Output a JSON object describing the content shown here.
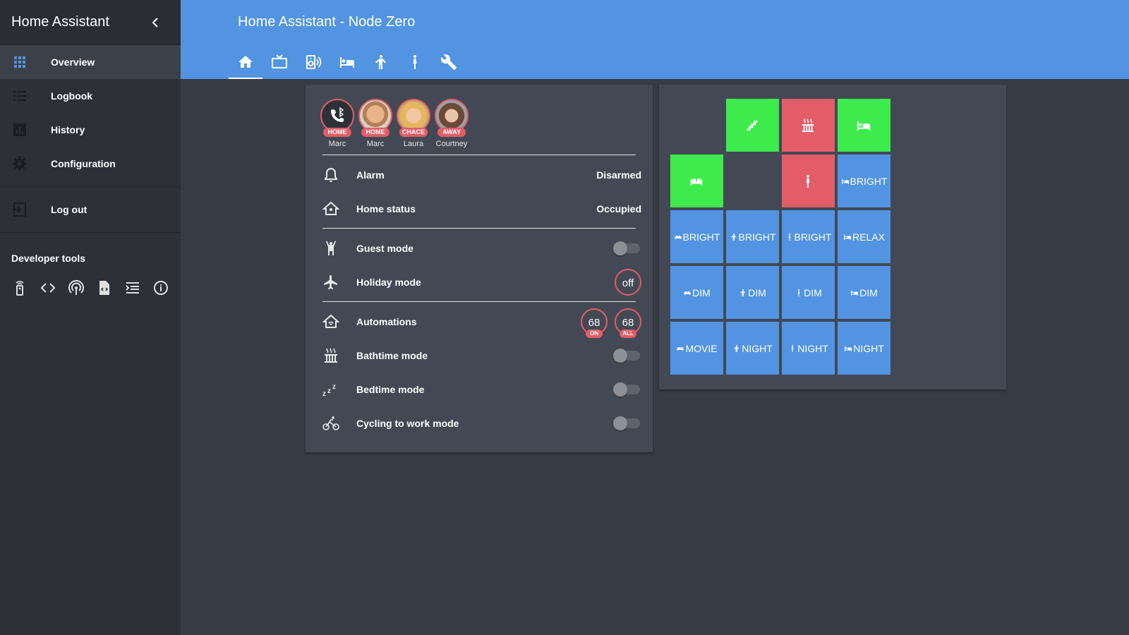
{
  "app": {
    "title": "Home Assistant",
    "page_title": "Home Assistant - Node Zero"
  },
  "sidebar": {
    "items": [
      {
        "label": "Overview",
        "icon": "apps-grid-icon"
      },
      {
        "label": "Logbook",
        "icon": "list-icon"
      },
      {
        "label": "History",
        "icon": "chart-icon"
      },
      {
        "label": "Configuration",
        "icon": "gear-icon"
      }
    ],
    "logout_label": "Log out",
    "dev_tools_title": "Developer tools",
    "dev_tools": [
      "remote-icon",
      "code-icon",
      "broadcast-icon",
      "file-code-icon",
      "log-icon",
      "info-icon"
    ]
  },
  "tabs": [
    "home-icon",
    "tv-icon",
    "speaker-icon",
    "bed-icon",
    "man-icon",
    "woman-icon",
    "wrench-icon"
  ],
  "people": [
    {
      "name": "Marc",
      "state": "HOME",
      "avatar": "phone-bluetooth-icon"
    },
    {
      "name": "Marc",
      "state": "HOME",
      "avatar": "photo"
    },
    {
      "name": "Laura",
      "state": "CHACE",
      "avatar": "photo"
    },
    {
      "name": "Courtney",
      "state": "AWAY",
      "avatar": "photo"
    }
  ],
  "rows": {
    "alarm": {
      "label": "Alarm",
      "value": "Disarmed"
    },
    "home_status": {
      "label": "Home status",
      "value": "Occupied"
    },
    "guest_mode": {
      "label": "Guest mode",
      "state": "off"
    },
    "holiday_mode": {
      "label": "Holiday mode",
      "value": "off"
    },
    "automations": {
      "label": "Automations",
      "on_count": "68",
      "on_label": "ON",
      "all_count": "68",
      "all_label": "ALL"
    },
    "bathtime_mode": {
      "label": "Bathtime mode",
      "state": "off"
    },
    "bedtime_mode": {
      "label": "Bedtime mode",
      "state": "off"
    },
    "cycling_mode": {
      "label": "Cycling to work mode",
      "state": "off"
    }
  },
  "tiles": [
    {
      "row": 0,
      "col": 1,
      "color": "green",
      "icon": "stairs-icon",
      "label": ""
    },
    {
      "row": 0,
      "col": 2,
      "color": "red",
      "icon": "radiator-icon",
      "label": ""
    },
    {
      "row": 0,
      "col": 3,
      "color": "green",
      "icon": "bed-icon",
      "label": ""
    },
    {
      "row": 1,
      "col": 0,
      "color": "green",
      "icon": "sofa-icon",
      "label": ""
    },
    {
      "row": 1,
      "col": 2,
      "color": "red",
      "icon": "woman-icon",
      "label": ""
    },
    {
      "row": 1,
      "col": 3,
      "color": "blue",
      "icon": "bed-icon",
      "label": "BRIGHT"
    },
    {
      "row": 2,
      "col": 0,
      "color": "blue",
      "icon": "sofa-icon",
      "label": "BRIGHT"
    },
    {
      "row": 2,
      "col": 1,
      "color": "blue",
      "icon": "man-icon",
      "label": "BRIGHT"
    },
    {
      "row": 2,
      "col": 2,
      "color": "blue",
      "icon": "woman-icon",
      "label": "BRIGHT"
    },
    {
      "row": 2,
      "col": 3,
      "color": "blue",
      "icon": "bed-icon",
      "label": "RELAX"
    },
    {
      "row": 3,
      "col": 0,
      "color": "blue",
      "icon": "sofa-icon",
      "label": "DIM"
    },
    {
      "row": 3,
      "col": 1,
      "color": "blue",
      "icon": "man-icon",
      "label": "DIM"
    },
    {
      "row": 3,
      "col": 2,
      "color": "blue",
      "icon": "woman-icon",
      "label": "DIM"
    },
    {
      "row": 3,
      "col": 3,
      "color": "blue",
      "icon": "bed-icon",
      "label": "DIM"
    },
    {
      "row": 4,
      "col": 0,
      "color": "blue",
      "icon": "sofa-icon",
      "label": "MOVIE"
    },
    {
      "row": 4,
      "col": 1,
      "color": "blue",
      "icon": "man-icon",
      "label": "NIGHT"
    },
    {
      "row": 4,
      "col": 2,
      "color": "blue",
      "icon": "woman-icon",
      "label": "NIGHT"
    },
    {
      "row": 4,
      "col": 3,
      "color": "blue",
      "icon": "bed-icon",
      "label": "NIGHT"
    }
  ],
  "colors": {
    "accent": "#5294e2",
    "green": "#3deb4c",
    "red": "#e25d68",
    "sidebar": "#2d3037",
    "background": "#373b44",
    "card": "#434954"
  }
}
